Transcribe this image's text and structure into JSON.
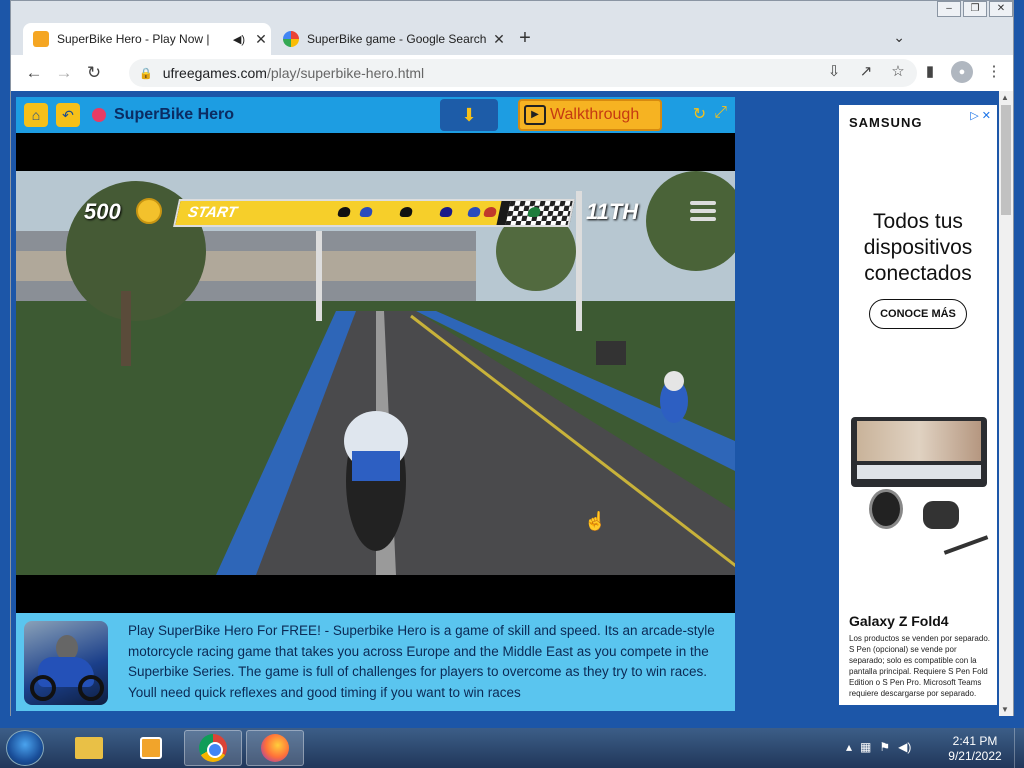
{
  "window": {
    "controls": [
      "–",
      "❐",
      "✕"
    ]
  },
  "tabs": [
    {
      "title": "SuperBike Hero - Play Now |",
      "active": true,
      "favicon_color": "#f5a623"
    },
    {
      "title": "SuperBike game - Google Search",
      "active": false
    }
  ],
  "toolbar": {
    "url_host": "ufreegames.com",
    "url_path": "/play/superbike-hero.html"
  },
  "game_header": {
    "title": "SuperBike Hero",
    "walkthrough_label": "Walkthrough"
  },
  "game_hud": {
    "coins": "500",
    "progress_label": "START",
    "progress_fraction": 0.82,
    "position": "11TH"
  },
  "description": {
    "text": "Play SuperBike Hero For FREE! - Superbike Hero is a game of skill and speed. Its an arcade-style motorcycle racing game that takes you across Europe and the Middle East as you compete in the Superbike Series. The game is full of challenges for players to overcome as they try to win races. Youll need quick reflexes and good timing if you want to win races"
  },
  "ad": {
    "brand": "SAMSUNG",
    "headline": "Todos tus dispositivos conectados",
    "cta": "CONOCE MÁS",
    "model": "Galaxy Z Fold4",
    "fine_print": "Los productos se venden por separado. S Pen (opcional) se vende por separado; solo es compatible con la pantalla principal. Requiere S Pen Fold Edition o S Pen Pro. Microsoft Teams requiere descargarse por separado."
  },
  "taskbar": {
    "time": "2:41 PM",
    "date": "9/21/2022"
  }
}
